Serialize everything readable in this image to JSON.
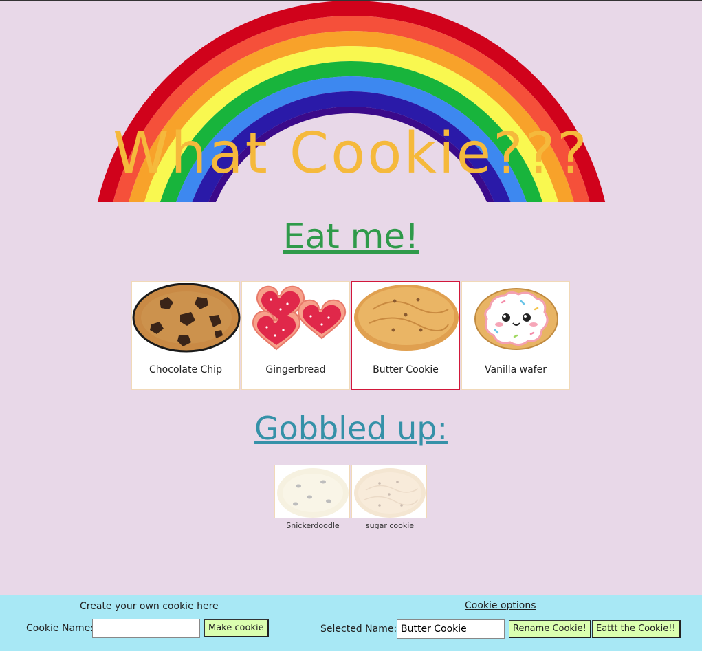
{
  "app": {
    "title": "What Cookie???"
  },
  "sections": {
    "eat_header": "Eat me!",
    "gobbled_header": "Gobbled up:"
  },
  "cookies": [
    {
      "name": "Chocolate Chip",
      "icon": "chocolate-chip-cookie-icon",
      "selected": false
    },
    {
      "name": "Gingerbread",
      "icon": "heart-cookies-icon",
      "selected": false
    },
    {
      "name": "Butter Cookie",
      "icon": "butter-cookie-icon",
      "selected": true
    },
    {
      "name": "Vanilla wafer",
      "icon": "frosted-cookie-icon",
      "selected": false
    }
  ],
  "eaten": [
    {
      "name": "Snickerdoodle",
      "icon": "snickerdoodle-icon"
    },
    {
      "name": "sugar cookie",
      "icon": "sugar-cookie-icon"
    }
  ],
  "footer": {
    "create_link": "Create your own cookie here",
    "cookie_name_label": "Cookie Name:",
    "cookie_name_value": "",
    "make_button": "Make cookie",
    "options_link": "Cookie options",
    "selected_name_label": "Selected Name:",
    "selected_name_value": "Butter Cookie",
    "rename_button": "Rename Cookie!",
    "eat_button": "Eattt the Cookie!!"
  },
  "colors": {
    "background": "#e8d8e8",
    "title": "#f5b93c",
    "eat_header": "#2f9a4a",
    "gobbled_header": "#3591a8",
    "footer": "#a8e8f5",
    "button": "#dbffb0",
    "selected_border": "#d2183a",
    "rainbow": [
      "#d0021b",
      "#f5503a",
      "#f8a22a",
      "#f9f850",
      "#18b43c",
      "#3d88f0",
      "#2a1aa8",
      "#3b0a8a"
    ]
  }
}
